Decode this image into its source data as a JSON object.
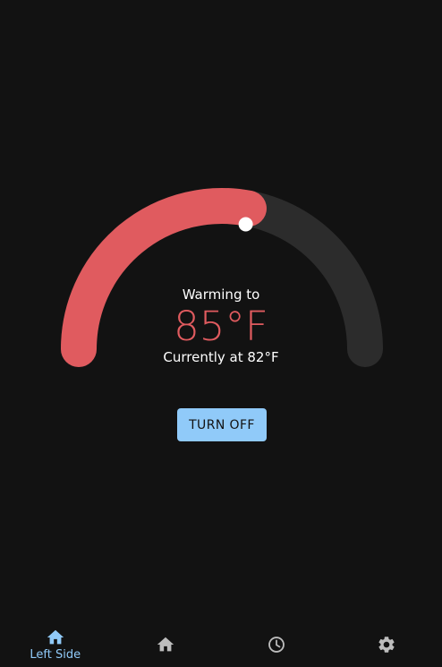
{
  "thermostat": {
    "status_label": "Warming to",
    "target_temp": "85°F",
    "current_temp": "Currently at 82°F",
    "setpoint_fraction": 0.56,
    "accent_color": "#E05B5F",
    "track_color": "#2C2C2C",
    "handle_color": "#FFFFFF"
  },
  "actions": {
    "turn_off_label": "TURN OFF",
    "turn_off_color": "#90CAF9"
  },
  "bottom_nav": {
    "items": [
      {
        "label": "Left Side",
        "icon": "home-icon",
        "active": true
      },
      {
        "label": "",
        "icon": "home-icon",
        "active": false
      },
      {
        "label": "",
        "icon": "clock-icon",
        "active": false
      },
      {
        "label": "",
        "icon": "gear-icon",
        "active": false
      }
    ],
    "active_color": "#90CAF9",
    "inactive_color": "#BDBDBD"
  }
}
